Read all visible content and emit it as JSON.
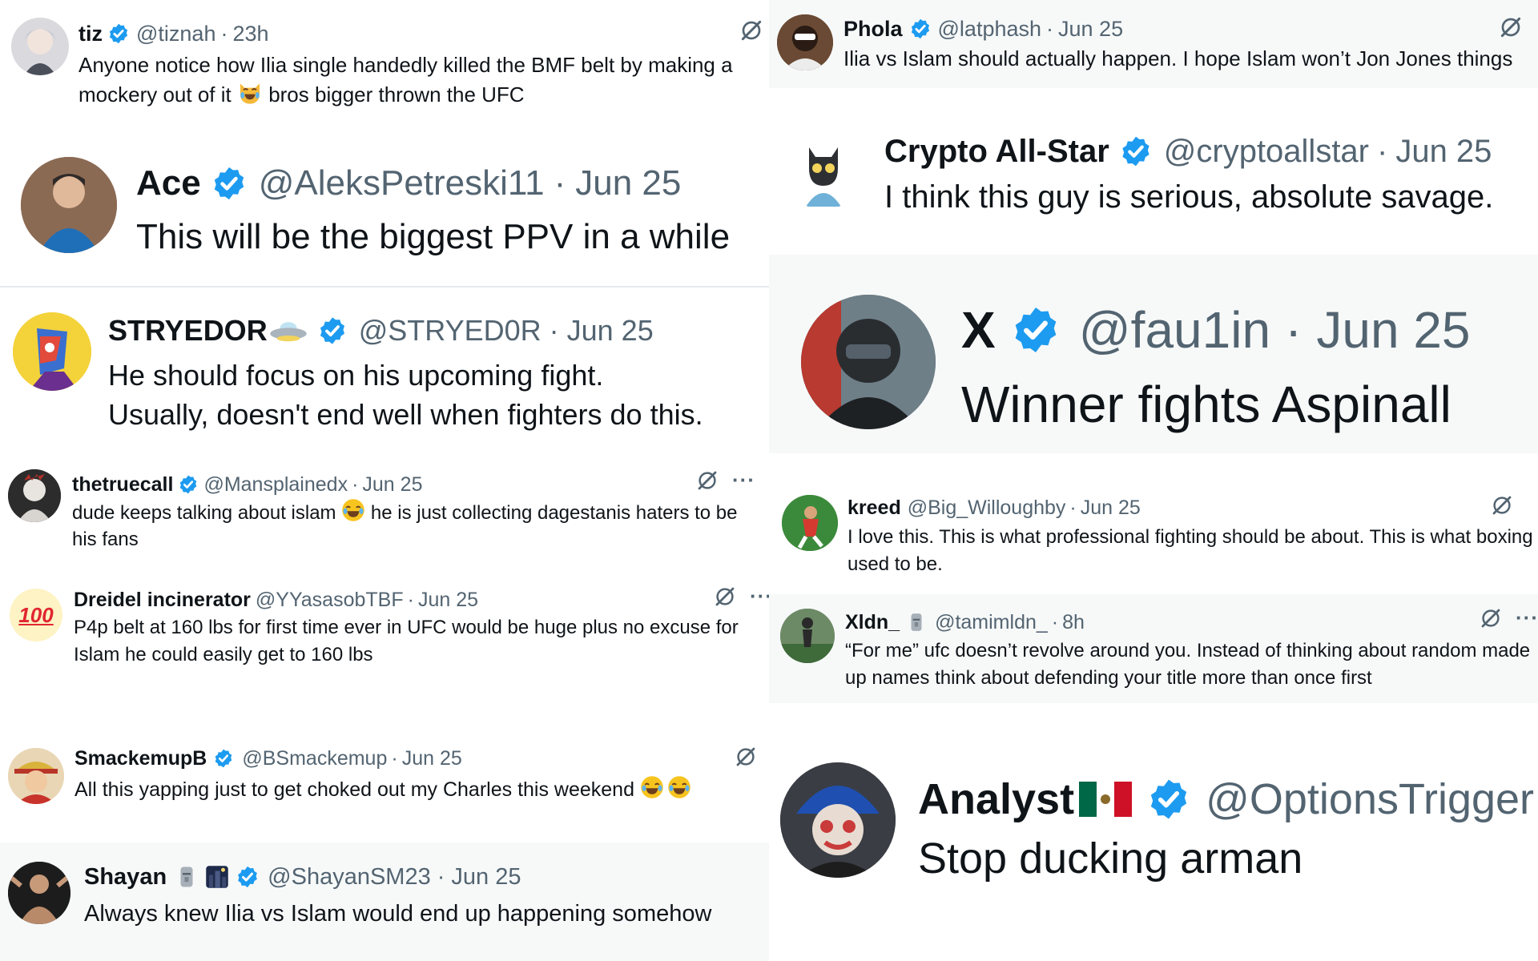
{
  "posts": [
    {
      "name": "tiz",
      "handle": "@tiznah",
      "sep": "·",
      "date": "23h",
      "text_a": "Anyone notice how Ilia single handedly killed the BMF belt by making a mockery out of it ",
      "text_b": " bros bigger thrown the UFC"
    },
    {
      "name": "Ace",
      "handle": "@AleksPetreski11",
      "sep": "·",
      "date": "Jun 25",
      "text": "This will be the biggest PPV in a while"
    },
    {
      "name": "STRYEDOR",
      "handle": "@STRYED0R",
      "sep": "·",
      "date": "Jun 25",
      "text_1": "He should focus on his upcoming fight.",
      "text_2": "Usually, doesn't end well when fighters do this."
    },
    {
      "name": "thetruecall",
      "handle": "@Mansplainedx",
      "sep": "·",
      "date": "Jun 25",
      "more": "···",
      "text_a": "dude keeps talking about islam ",
      "text_b": " he is just collecting dagestanis haters to be his fans"
    },
    {
      "name": "Dreidel incinerator",
      "handle": "@YYasasobTBF",
      "sep": "·",
      "date": "Jun 25",
      "more": "···",
      "avatar_text": "100",
      "text": "P4p belt at 160 lbs for first time ever in UFC would be huge plus no excuse for Islam he could easily get to 160 lbs"
    },
    {
      "name": "SmackemupB",
      "handle": "@BSmackemup",
      "sep": "·",
      "date": "Jun 25",
      "text": "All this yapping just to get choked out my Charles this weekend "
    },
    {
      "name": "Shayan",
      "handle": "@ShayanSM23",
      "sep": "·",
      "date": "Jun 25",
      "text": "Always knew Ilia vs Islam would end up happening somehow"
    },
    {
      "name": "Phola",
      "handle": "@latphash",
      "sep": "·",
      "date": "Jun 25",
      "text": "Ilia vs Islam should actually happen. I hope Islam won’t Jon Jones things"
    },
    {
      "name": "Crypto All-Star",
      "handle": "@cryptoallstar",
      "sep": "·",
      "date": "Jun 25",
      "text": "I think this guy is serious, absolute savage."
    },
    {
      "name": "X",
      "handle": "@fau1in",
      "sep": "·",
      "date": "Jun 25",
      "text": "Winner fights Aspinall"
    },
    {
      "name": "kreed",
      "handle": "@Big_Willoughby",
      "sep": "·",
      "date": "Jun 25",
      "text": "I love this. This is what professional fighting should be about. This is what boxing used to be."
    },
    {
      "name": "Xldn_",
      "handle": "@tamimldn_",
      "sep": "·",
      "date": "8h",
      "more": "···",
      "text": "“For me” ufc doesn’t revolve around you. Instead of thinking about random made up names think about defending your title more than once first"
    },
    {
      "name": "Analyst",
      "handle": "@OptionsTrigger",
      "text": "Stop ducking arman"
    }
  ],
  "icons": {
    "verified": "verified-badge-icon",
    "grok": "grok-icon",
    "more": "more-icon",
    "emoji_cat": "crying-cat-emoji-icon",
    "emoji_laugh": "tears-of-joy-emoji-icon",
    "emoji_ufo": "ufo-emoji-icon",
    "emoji_moai": "moai-emoji-icon",
    "emoji_night": "night-city-emoji-icon",
    "flag_mexico": "mexico-flag-icon"
  },
  "colors": {
    "verified": "#1d9bf0",
    "text": "#0f1419",
    "muted": "#536471",
    "panel": "#f7f9f9"
  }
}
